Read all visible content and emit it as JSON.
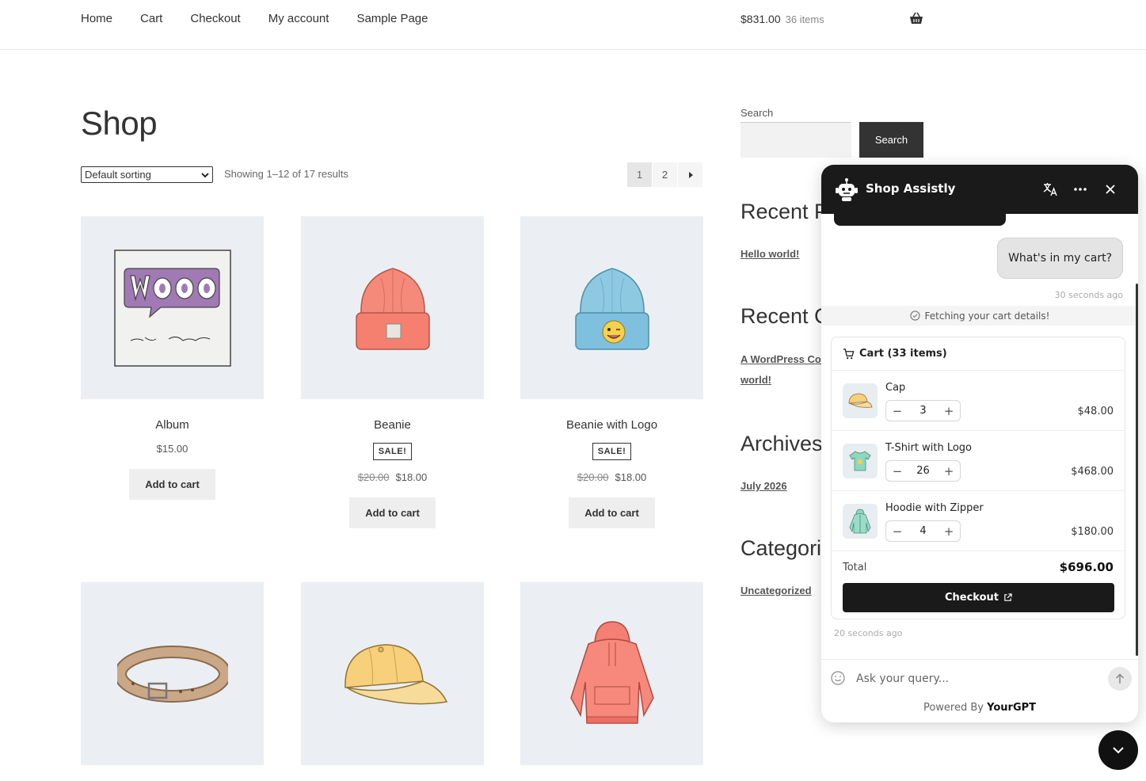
{
  "nav": {
    "items": [
      "Home",
      "Cart",
      "Checkout",
      "My account",
      "Sample Page"
    ]
  },
  "header_cart": {
    "total": "$831.00",
    "count": "36 items"
  },
  "shop": {
    "title": "Shop",
    "sorting": "Default sorting",
    "results": "Showing 1–12 of 17 results",
    "pages": [
      "1",
      "2"
    ],
    "products": [
      {
        "name": "Album",
        "price": "$15.00",
        "button": "Add to cart"
      },
      {
        "name": "Beanie",
        "sale_badge": "SALE!",
        "old_price": "$20.00",
        "price": "$18.00",
        "button": "Add to cart"
      },
      {
        "name": "Beanie with Logo",
        "sale_badge": "SALE!",
        "old_price": "$20.00",
        "price": "$18.00",
        "button": "Add to cart"
      }
    ]
  },
  "sidebar": {
    "search_label": "Search",
    "search_button": "Search",
    "recent_posts_title": "Recent Po",
    "recent_post_link": "Hello world!",
    "recent_comments_title": "Recent Co",
    "recent_comment_link_1": "A WordPress Com",
    "recent_comment_link_2": "world!",
    "archives_title": "Archives",
    "archive_link": "July 2026",
    "categories_title": "Categorie",
    "category_link": "Uncategorized"
  },
  "chat": {
    "title": "Shop Assistly",
    "user_message": "What's in my cart?",
    "user_message_time": "30 seconds ago",
    "status": "Fetching your cart details!",
    "cart_header": "Cart (33 items)",
    "items": [
      {
        "name": "Cap",
        "qty": "3",
        "price": "$48.00"
      },
      {
        "name": "T-Shirt with Logo",
        "qty": "26",
        "price": "$468.00"
      },
      {
        "name": "Hoodie with Zipper",
        "qty": "4",
        "price": "$180.00"
      }
    ],
    "total_label": "Total",
    "total_value": "$696.00",
    "checkout_label": "Checkout",
    "reply_time": "20 seconds ago",
    "input_placeholder": "Ask your query...",
    "powered_prefix": "Powered By",
    "powered_brand": "YourGPT"
  },
  "colors": {
    "chat_header": "#1a1a1a",
    "thumb_bg": "#ebeff3"
  }
}
